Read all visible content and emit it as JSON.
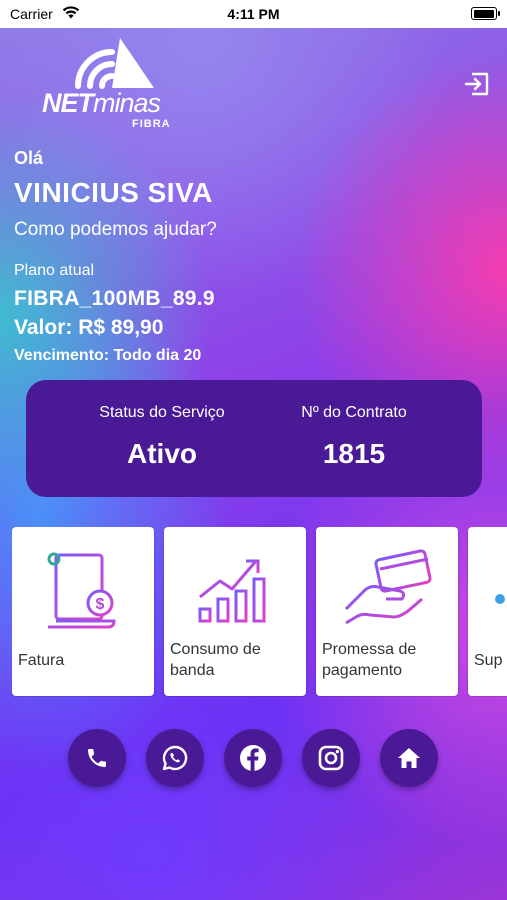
{
  "status_bar": {
    "carrier": "Carrier",
    "time": "4:11 PM"
  },
  "logo": {
    "brand_net": "NET",
    "brand_minas": "minas",
    "brand_sub": "FIBRA"
  },
  "greeting": {
    "hello": "Olá",
    "name": "VINICIUS SIVA",
    "question": "Como podemos ajudar?"
  },
  "plan": {
    "label": "Plano atual",
    "name": "FIBRA_100MB_89.9",
    "value": "Valor: R$ 89,90",
    "due": "Vencimento: Todo dia 20"
  },
  "service": {
    "status_label": "Status do Serviço",
    "status_value": "Ativo",
    "contract_label": "Nº do Contrato",
    "contract_value": "1815"
  },
  "tiles": [
    {
      "label": "Fatura",
      "icon": "invoice-icon"
    },
    {
      "label": "Consumo de banda",
      "icon": "bandwidth-chart-icon"
    },
    {
      "label": "Promessa de pagamento",
      "icon": "card-payment-icon"
    },
    {
      "label": "Sup",
      "icon": "support-icon"
    }
  ],
  "social": [
    {
      "icon": "phone-icon"
    },
    {
      "icon": "whatsapp-icon"
    },
    {
      "icon": "facebook-icon"
    },
    {
      "icon": "instagram-icon"
    },
    {
      "icon": "home-icon"
    }
  ],
  "colors": {
    "card_bg": "#4a1a96",
    "accent_purple": "#7a2fd9",
    "icon_gradient_start": "#7a5af8",
    "icon_gradient_end": "#e040c8"
  }
}
